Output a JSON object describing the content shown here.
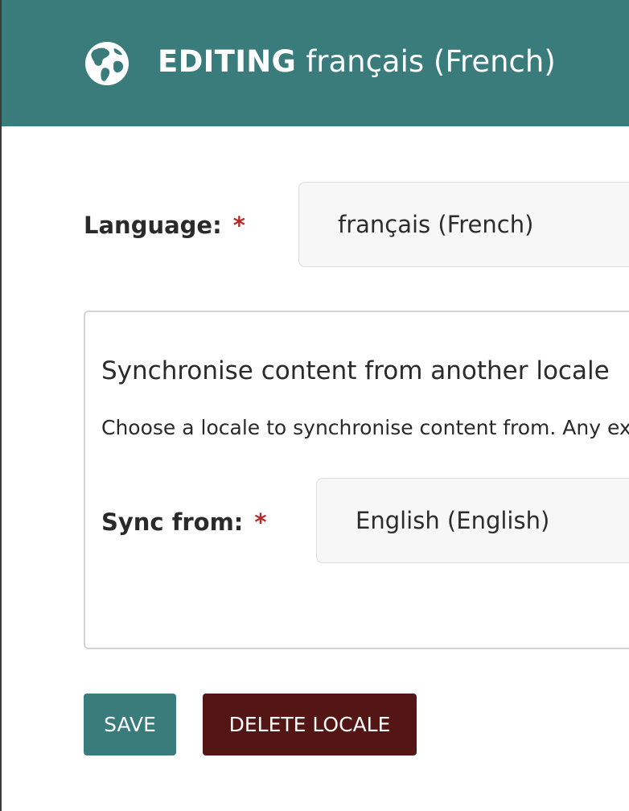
{
  "header": {
    "title_strong": "EDITING",
    "title_locale": "français (French)",
    "icon": "globe-icon"
  },
  "language_field": {
    "label": "Language:",
    "required_marker": "*",
    "value": "français (French)"
  },
  "sync_panel": {
    "title": "Synchronise content from another locale",
    "help_text": "Choose a locale to synchronise content from. Any ex",
    "sync_from": {
      "label": "Sync from:",
      "required_marker": "*",
      "value": "English (English)"
    }
  },
  "actions": {
    "save_label": "SAVE",
    "delete_label": "DELETE LOCALE"
  },
  "colors": {
    "header_bg": "#3a7c7c",
    "save_bg": "#3a7c7c",
    "delete_bg": "#541515",
    "required": "#b72a2a"
  }
}
